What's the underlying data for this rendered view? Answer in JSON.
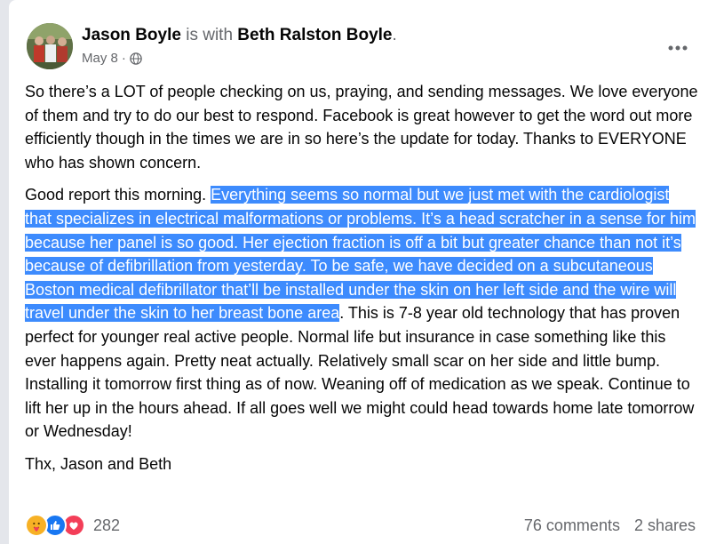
{
  "post": {
    "author": "Jason Boyle",
    "with_text": "is with",
    "tagged": "Beth Ralston Boyle",
    "tagged_suffix": ".",
    "date": "May 8",
    "separator": "·",
    "privacy_icon": "globe-icon",
    "more_icon": "more-options-icon",
    "paragraph1": "So there’s a LOT of people checking on us, praying, and sending messages.  We love everyone of them and try to do our best to respond.  Facebook is great however to get the word out more efficiently though in the times we are in so here’s the update for today.  Thanks to EVERYONE who has shown concern.",
    "paragraph2_before": "Good report this morning.  ",
    "paragraph2_highlight": "Everything seems so normal but we just met with the cardiologist that specializes in electrical malformations or problems.  It’s a head scratcher in a sense for him because her panel is so good.  Her ejection fraction is off a bit but greater chance than not it’s because of defibrillation from yesterday.  To be safe, we have decided on a subcutaneous Boston medical defibrillator that’ll be installed under the skin on her left side and the wire will travel under the skin to her breast bone area",
    "paragraph2_after": ".  This is 7-8 year old technology that has proven perfect for younger real active people.  Normal life but insurance in case something like this ever happens again.  Pretty neat actually.  Relatively small scar on her side and little bump.  Installing it tomorrow first thing as of now.  Weaning off of medication as we speak.  Continue to lift her up in the hours ahead.  If all goes well we might could head towards home late tomorrow or Wednesday!",
    "signoff": "Thx, Jason and Beth",
    "highlight_color": "#3d8bfd"
  },
  "footer": {
    "reactions": [
      "care-reaction-icon",
      "like-reaction-icon",
      "love-reaction-icon"
    ],
    "reaction_count": "282",
    "comments": "76 comments",
    "shares": "2 shares"
  }
}
